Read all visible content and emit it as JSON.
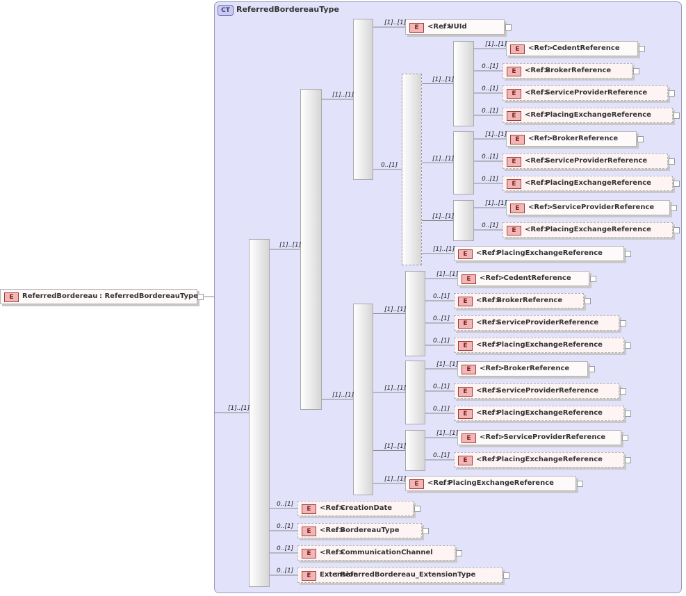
{
  "diagram": {
    "complex_type": {
      "badge": "CT",
      "name": "ReferredBordereauType"
    },
    "root": {
      "badge": "E",
      "name": "ReferredBordereau",
      "type": ": ReferredBordereauType"
    },
    "colors": {
      "background": "#e2e2fb",
      "element_fill": "#fffafa",
      "element_icon": "#f2b6b6",
      "connector": "#444444"
    },
    "icons": {
      "element": "element-icon",
      "sequence": "sequence-connector-icon",
      "expand": "plus-icon"
    },
    "elements": [
      {
        "id": "uuid",
        "label": "<Ref>",
        "type": ": UUId",
        "card": "[1]..[1]",
        "optional": false
      },
      {
        "id": "cedent-1",
        "label": "<Ref>",
        "type": ": CedentReference",
        "card": "[1]..[1]",
        "optional": false
      },
      {
        "id": "broker-1",
        "label": "<Ref>",
        "type": ": BrokerReference",
        "card": "0..[1]",
        "optional": true
      },
      {
        "id": "sp-1",
        "label": "<Ref>",
        "type": ": ServiceProviderReference",
        "card": "0..[1]",
        "optional": true
      },
      {
        "id": "pe-1",
        "label": "<Ref>",
        "type": ": PlacingExchangeReference",
        "card": "0..[1]",
        "optional": true
      },
      {
        "id": "broker-2",
        "label": "<Ref>",
        "type": ": BrokerReference",
        "card": "[1]..[1]",
        "optional": false
      },
      {
        "id": "sp-2",
        "label": "<Ref>",
        "type": ": ServiceProviderReference",
        "card": "0..[1]",
        "optional": true
      },
      {
        "id": "pe-2",
        "label": "<Ref>",
        "type": ": PlacingExchangeReference",
        "card": "0..[1]",
        "optional": true
      },
      {
        "id": "sp-3",
        "label": "<Ref>",
        "type": ": ServiceProviderReference",
        "card": "[1]..[1]",
        "optional": false
      },
      {
        "id": "pe-3",
        "label": "<Ref>",
        "type": ": PlacingExchangeReference",
        "card": "0..[1]",
        "optional": true
      },
      {
        "id": "pe-4",
        "label": "<Ref>",
        "type": ": PlacingExchangeReference",
        "card": "[1]..[1]",
        "optional": false
      },
      {
        "id": "cedent-2",
        "label": "<Ref>",
        "type": ": CedentReference",
        "card": "[1]..[1]",
        "optional": false
      },
      {
        "id": "broker-3",
        "label": "<Ref>",
        "type": ": BrokerReference",
        "card": "0..[1]",
        "optional": true
      },
      {
        "id": "sp-4",
        "label": "<Ref>",
        "type": ": ServiceProviderReference",
        "card": "0..[1]",
        "optional": true
      },
      {
        "id": "pe-5",
        "label": "<Ref>",
        "type": ": PlacingExchangeReference",
        "card": "0..[1]",
        "optional": true
      },
      {
        "id": "broker-4",
        "label": "<Ref>",
        "type": ": BrokerReference",
        "card": "[1]..[1]",
        "optional": false
      },
      {
        "id": "sp-5",
        "label": "<Ref>",
        "type": ": ServiceProviderReference",
        "card": "0..[1]",
        "optional": true
      },
      {
        "id": "pe-6",
        "label": "<Ref>",
        "type": ": PlacingExchangeReference",
        "card": "0..[1]",
        "optional": true
      },
      {
        "id": "sp-6",
        "label": "<Ref>",
        "type": ": ServiceProviderReference",
        "card": "[1]..[1]",
        "optional": false
      },
      {
        "id": "pe-7",
        "label": "<Ref>",
        "type": ": PlacingExchangeReference",
        "card": "0..[1]",
        "optional": true
      },
      {
        "id": "pe-8",
        "label": "<Ref>",
        "type": ": PlacingExchangeReference",
        "card": "[1]..[1]",
        "optional": false
      },
      {
        "id": "creation-date",
        "label": "<Ref>",
        "type": ": CreationDate",
        "card": "0..[1]",
        "optional": true
      },
      {
        "id": "bordereau-type",
        "label": "<Ref>",
        "type": ": BordereauType",
        "card": "0..[1]",
        "optional": true
      },
      {
        "id": "comm-channel",
        "label": "<Ref>",
        "type": ": CommunicationChannel",
        "card": "0..[1]",
        "optional": true
      },
      {
        "id": "extension",
        "label": "Extension",
        "type": ": ReferredBordereau_ExtensionType",
        "card": "0..[1]",
        "optional": true
      }
    ],
    "sequences": [
      {
        "id": "main",
        "card": "[1]..[1]",
        "optional": false
      },
      {
        "id": "s2",
        "card": "[1]..[1]",
        "optional": false
      },
      {
        "id": "s3a",
        "card": "[1]..[1]",
        "optional": false
      },
      {
        "id": "s4",
        "card": "0..[1]",
        "optional": true
      },
      {
        "id": "s5a",
        "card": "[1]..[1]",
        "optional": false
      },
      {
        "id": "s5b",
        "card": "[1]..[1]",
        "optional": false
      },
      {
        "id": "s5c",
        "card": "[1]..[1]",
        "optional": false
      },
      {
        "id": "s3b",
        "card": "[1]..[1]",
        "optional": false
      },
      {
        "id": "s6a",
        "card": "[1]..[1]",
        "optional": false
      },
      {
        "id": "s6b",
        "card": "[1]..[1]",
        "optional": false
      },
      {
        "id": "s6c",
        "card": "[1]..[1]",
        "optional": false
      }
    ]
  }
}
